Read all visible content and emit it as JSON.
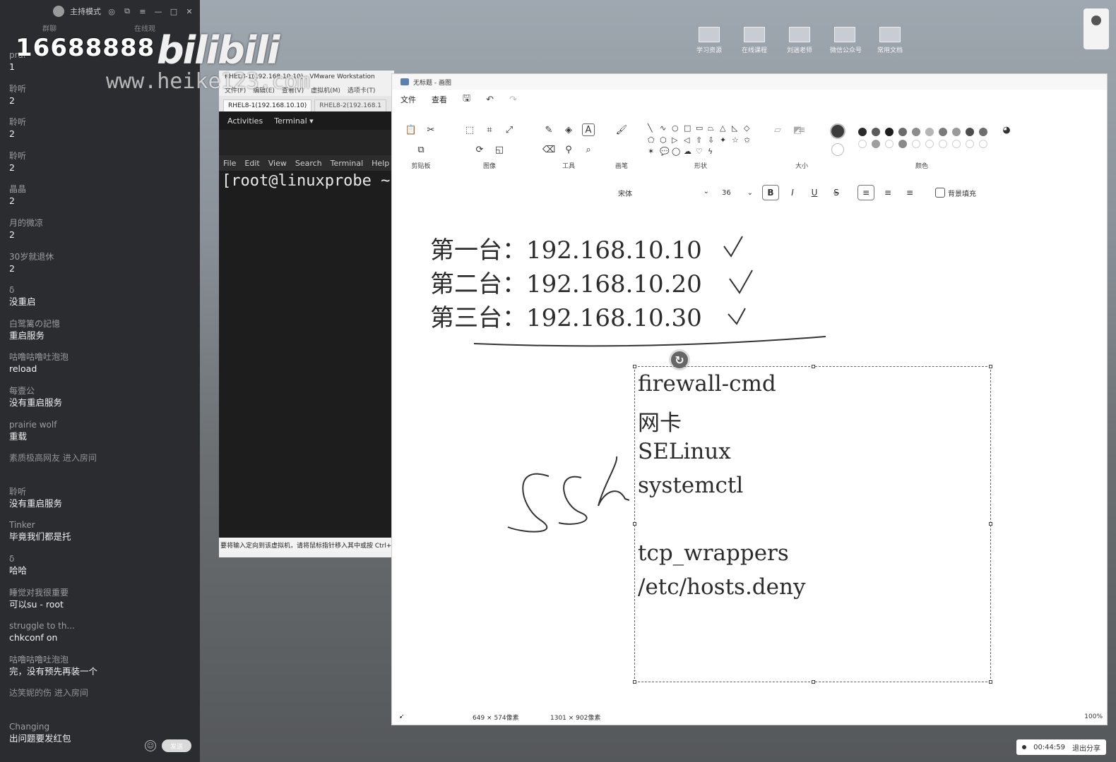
{
  "chat": {
    "title": "主持模式",
    "header_labels": [
      "群聊",
      "在线观"
    ],
    "messages": [
      {
        "user": "prai",
        "text": "1"
      },
      {
        "user": "聆听",
        "text": "2"
      },
      {
        "user": "聆听",
        "text": "2"
      },
      {
        "user": "聆听",
        "text": "2"
      },
      {
        "user": "晶晶",
        "text": "2"
      },
      {
        "user": "月的微凉",
        "text": "2"
      },
      {
        "user": "30岁就退休",
        "text": "2"
      },
      {
        "user": "δ",
        "text": "没重启"
      },
      {
        "user": "白鹭篱の記憶",
        "text": "重启服务"
      },
      {
        "user": "咕噜咕噜吐泡泡",
        "text": "reload"
      },
      {
        "user": "每壹公",
        "text": "没有重启服务"
      },
      {
        "user": "prairie wolf",
        "text": "重载"
      },
      {
        "user": "素质极高网友 进入房间",
        "text": ""
      },
      {
        "user": "聆听",
        "text": "没有重启服务"
      },
      {
        "user": "Tinker",
        "text": "毕竟我们都是托"
      },
      {
        "user": "δ",
        "text": "哈哈"
      },
      {
        "user": "睡觉对我很重要",
        "text": "可以su - root"
      },
      {
        "user": "struggle to th...",
        "text": "chkconf on"
      },
      {
        "user": "咕噜咕噜吐泡泡",
        "text": "完，没有预先再装一个"
      },
      {
        "user": "达笑妮的伤 进入房间",
        "text": ""
      },
      {
        "user": "Changing",
        "text": "出问题要发红包"
      }
    ],
    "send_label": "发送"
  },
  "watermark": {
    "number": "16688888",
    "brand": "bilibili",
    "url": "www.heike123.com"
  },
  "desktop": {
    "shortcuts": [
      "学习资源",
      "在线课程",
      "刘遄老师",
      "微信公众号",
      "常用文档"
    ]
  },
  "vmware": {
    "title": "RHEL8-1(192.168.10.10) - VMware Workstation",
    "menu": [
      "文件(F)",
      "编辑(E)",
      "查看(V)",
      "虚拟机(M)",
      "选项卡(T)"
    ],
    "tabs": [
      "RHEL8-1(192.168.10.10)",
      "RHEL8-2(192.168.1"
    ],
    "gnome_activities": "Activities",
    "gnome_app": "Terminal ▾",
    "term_menu": [
      "File",
      "Edit",
      "View",
      "Search",
      "Terminal",
      "Help"
    ],
    "prompt": "[root@linuxprobe ~",
    "status": "要将输入定向到该虚拟机，请将鼠标指针移入其中或按 Ctrl+G"
  },
  "paint": {
    "title": "无标题 - 画图",
    "menu": [
      "文件",
      "查看"
    ],
    "groups": {
      "clipboard": "剪贴板",
      "image": "图像",
      "tools": "工具",
      "brushes": "画笔",
      "shapes": "形状",
      "size": "大小",
      "colors": "颜色"
    },
    "font": "宋体",
    "font_size": "36",
    "bg_fill_label": "背景填充",
    "canvas": {
      "ip_lines": [
        "第一台：192.168.10.10",
        "第二台：192.168.10.20",
        "第三台：192.168.10.30"
      ],
      "handwriting": "ssh",
      "textbox_lines": [
        "firewall-cmd",
        "网卡",
        "SELinux",
        "systemctl",
        "",
        "tcp_wrappers",
        "/etc/hosts.deny"
      ]
    },
    "status": {
      "selection_size": "649 × 574像素",
      "canvas_size": "1301 × 902像素",
      "zoom": "100%"
    }
  },
  "recorder": {
    "time": "00:44:59",
    "exit_label": "退出分享"
  },
  "colors": {
    "palette": [
      "#2a2a2a",
      "#5a5a5a",
      "#1e1e1e",
      "#6b6b6b",
      "#8c8c8c",
      "#b5b5b5",
      "#7a7a7a",
      "#9a9a9a",
      "#4d4d4d",
      "#6e6e6e",
      "#ffffff",
      "#9f9f9f",
      "#3d3d3d",
      "#8a8a8a",
      "#c0c0c0",
      "#a5a5a5",
      "#888888",
      "#b0b0b0",
      "#999999",
      "#a9a9a9"
    ]
  }
}
